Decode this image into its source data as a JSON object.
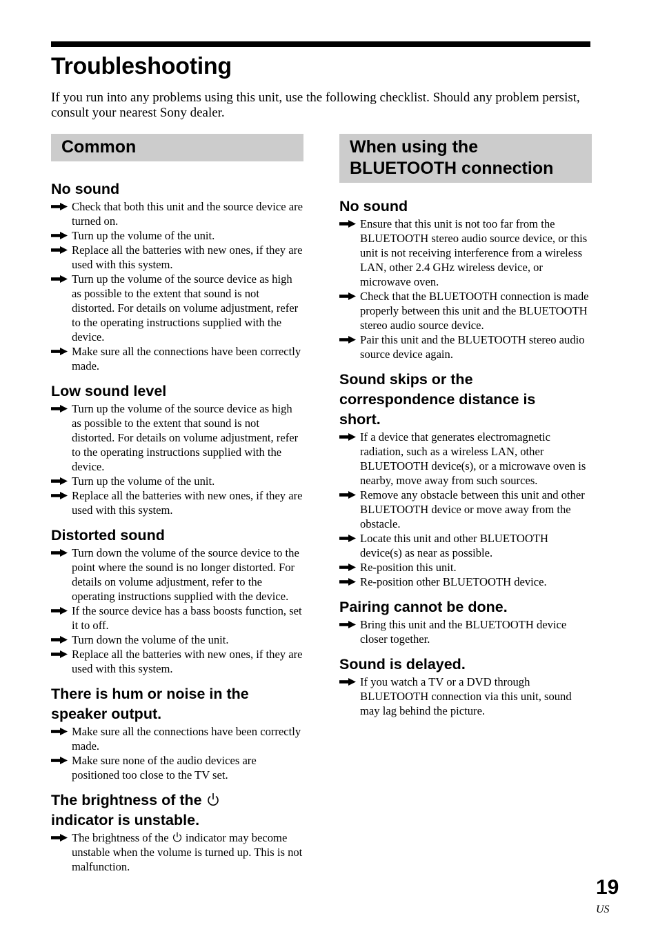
{
  "page": {
    "title": "Troubleshooting",
    "intro": "If you run into any problems using this unit, use the following checklist. Should any problem persist, consult your nearest Sony dealer.",
    "page_number": "19",
    "region_code": "US",
    "section_bar_color": "#cccccc"
  },
  "common": {
    "heading": "Common",
    "topics": [
      {
        "title": "No sound",
        "items": [
          "Check that both this unit and the source device are turned on.",
          "Turn up the volume of the unit.",
          "Replace all the batteries with new ones, if they are used with this system.",
          "Turn up the volume of the source device as high as possible to the extent that sound is not distorted. For details on volume adjustment, refer to the operating instructions supplied with the device.",
          "Make sure all the connections have been correctly made."
        ]
      },
      {
        "title": "Low sound level",
        "items": [
          "Turn up the volume of the source device as high as possible to the extent that sound is not distorted. For details on volume adjustment, refer to the operating instructions supplied with the device.",
          "Turn up the volume of the unit.",
          "Replace all the batteries with new ones, if they are used with this system."
        ]
      },
      {
        "title": "Distorted sound",
        "items": [
          "Turn down the volume of the source device to the point where the sound is no longer distorted. For details on volume adjustment, refer to the operating instructions supplied with the device.",
          "If the source device has a bass boosts function, set it to off.",
          "Turn down the volume of the unit.",
          "Replace all the batteries with new ones, if they are used with this system."
        ]
      },
      {
        "title": "There is hum or noise in the speaker output.",
        "items": [
          "Make sure all the connections have been correctly made.",
          "Make sure none of the audio devices are positioned too close to the TV set."
        ]
      },
      {
        "title_part1": "The brightness of the",
        "title_part2": "indicator is unstable.",
        "items_part1": "The brightness of the",
        "items_part2": "indicator may become unstable when the volume is turned up. This is not malfunction."
      }
    ]
  },
  "bluetooth": {
    "heading_line1": "When using the",
    "heading_line2": "BLUETOOTH connection",
    "topics": [
      {
        "title": "No sound",
        "items": [
          "Ensure that this unit is not too far from the BLUETOOTH stereo audio source device, or this unit is not receiving interference from a wireless LAN, other 2.4 GHz wireless device, or microwave oven.",
          "Check that the BLUETOOTH connection is made properly between this unit and the BLUETOOTH stereo audio source device.",
          "Pair this unit and the BLUETOOTH stereo audio source device again."
        ]
      },
      {
        "title": "Sound skips or the correspondence distance is short.",
        "items": [
          "If a device that generates electromagnetic radiation, such as a wireless LAN, other BLUETOOTH device(s), or a microwave oven is nearby, move away from such sources.",
          "Remove any obstacle between this unit and other BLUETOOTH device or move away from the obstacle.",
          "Locate this unit and other BLUETOOTH device(s) as near as possible.",
          "Re-position this unit.",
          "Re-position other BLUETOOTH device."
        ]
      },
      {
        "title": "Pairing cannot be done.",
        "items": [
          "Bring this unit and the BLUETOOTH device closer together."
        ]
      },
      {
        "title": "Sound is delayed.",
        "items": [
          "If you watch a TV or a DVD through BLUETOOTH connection via this unit, sound may lag behind the picture."
        ]
      }
    ]
  }
}
